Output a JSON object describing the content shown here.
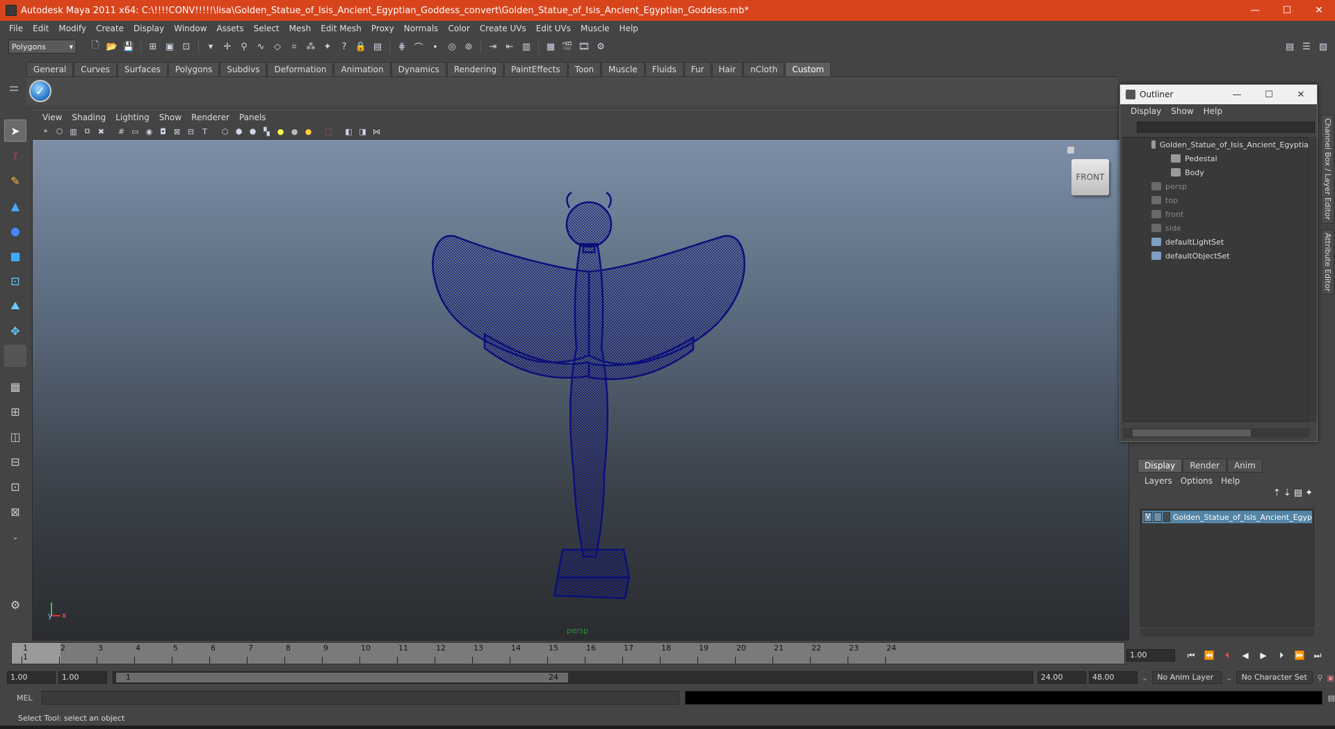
{
  "window": {
    "title": "Autodesk Maya 2011 x64: C:\\!!!!CONV!!!!!\\lisa\\Golden_Statue_of_Isis_Ancient_Egyptian_Goddess_convert\\Golden_Statue_of_Isis_Ancient_Egyptian_Goddess.mb*",
    "minimize": "—",
    "maximize": "☐",
    "close": "✕"
  },
  "menubar": [
    "File",
    "Edit",
    "Modify",
    "Create",
    "Display",
    "Window",
    "Assets",
    "Select",
    "Mesh",
    "Edit Mesh",
    "Proxy",
    "Normals",
    "Color",
    "Create UVs",
    "Edit UVs",
    "Muscle",
    "Help"
  ],
  "statusline": {
    "mode": "Polygons"
  },
  "shelf": {
    "tabs": [
      "General",
      "Curves",
      "Surfaces",
      "Polygons",
      "Subdivs",
      "Deformation",
      "Animation",
      "Dynamics",
      "Rendering",
      "PaintEffects",
      "Toon",
      "Muscle",
      "Fluids",
      "Fur",
      "Hair",
      "nCloth",
      "Custom"
    ],
    "active_tab": "Custom"
  },
  "panel": {
    "menus": [
      "View",
      "Shading",
      "Lighting",
      "Show",
      "Renderer",
      "Panels"
    ],
    "camera": "persp",
    "viewcube_label": "FRONT",
    "axis_y": "y",
    "axis_x": "x",
    "mesh_color": "#0b0f7a"
  },
  "outliner": {
    "title": "Outliner",
    "menus": [
      "Display",
      "Show",
      "Help"
    ],
    "items": [
      {
        "label": "Golden_Statue_of_Isis_Ancient_Egyptia",
        "dim": false,
        "indent": 0
      },
      {
        "label": "Pedestal",
        "dim": false,
        "indent": 2
      },
      {
        "label": "Body",
        "dim": false,
        "indent": 2
      },
      {
        "label": "persp",
        "dim": true,
        "indent": 0
      },
      {
        "label": "top",
        "dim": true,
        "indent": 0
      },
      {
        "label": "front",
        "dim": true,
        "indent": 0
      },
      {
        "label": "side",
        "dim": true,
        "indent": 0
      },
      {
        "label": "defaultLightSet",
        "dim": false,
        "indent": 0
      },
      {
        "label": "defaultObjectSet",
        "dim": false,
        "indent": 0
      }
    ]
  },
  "side_tabs": {
    "channel_box": "Channel Box / Layer Editor",
    "attribute_editor": "Attribute Editor"
  },
  "layer_editor": {
    "tabs": [
      "Display",
      "Render",
      "Anim"
    ],
    "active_tab": "Display",
    "menus": [
      "Layers",
      "Options",
      "Help"
    ],
    "layer": {
      "visible": "V",
      "name": "Golden_Statue_of_Isis_Ancient_Egyp"
    }
  },
  "timeline": {
    "ticks": [
      "1",
      "2",
      "3",
      "4",
      "5",
      "6",
      "7",
      "8",
      "9",
      "10",
      "11",
      "12",
      "13",
      "14",
      "15",
      "16",
      "17",
      "18",
      "19",
      "20",
      "21",
      "22",
      "23",
      "24"
    ],
    "current_frame_marker": "1",
    "current_frame": "1.00"
  },
  "range": {
    "start": "1.00",
    "playback_start": "1.00",
    "range_start_label": "1",
    "range_end_label": "24",
    "playback_end": "24.00",
    "end": "48.00",
    "anim_layer": "No Anim Layer",
    "character_set": "No Character Set"
  },
  "command": {
    "label": "MEL"
  },
  "helpline": "Select Tool: select an object"
}
